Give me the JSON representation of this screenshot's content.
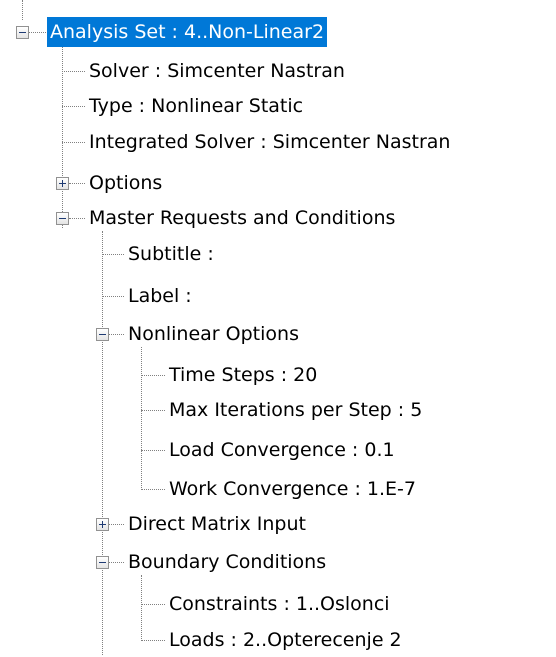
{
  "tree": {
    "root": {
      "label": "Analysis Set : 4..Non-Linear2",
      "expanded": true,
      "selected": true
    },
    "solver": "Solver : Simcenter Nastran",
    "type": "Type : Nonlinear Static",
    "integrated_solver": "Integrated Solver : Simcenter Nastran",
    "options": {
      "label": "Options",
      "expanded": false
    },
    "master_requests": {
      "label": "Master Requests and Conditions",
      "expanded": true,
      "subtitle": "Subtitle :",
      "label_item": "Label :",
      "nonlinear_options": {
        "label": "Nonlinear Options",
        "expanded": true,
        "time_steps": "Time Steps : 20",
        "max_iterations": "Max Iterations per Step : 5",
        "load_convergence": "Load Convergence : 0.1",
        "work_convergence": "Work Convergence : 1.E-7"
      },
      "direct_matrix_input": {
        "label": "Direct Matrix Input",
        "expanded": false
      },
      "boundary_conditions": {
        "label": "Boundary Conditions",
        "expanded": true,
        "constraints": "Constraints : 1..Oslonci",
        "loads": "Loads : 2..Opterecenje 2"
      }
    }
  },
  "colors": {
    "selection_background": "#0078d7",
    "selection_text": "#ffffff",
    "tree_lines": "#808080",
    "expander_border": "#919191"
  }
}
